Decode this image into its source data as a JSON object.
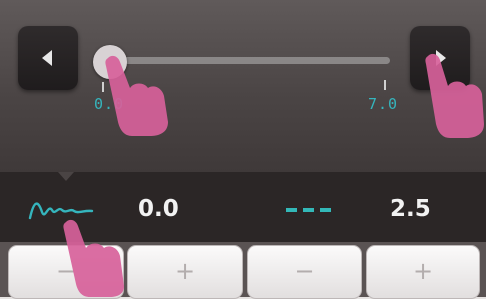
{
  "slider": {
    "value": 0.0,
    "min_label": "0.0",
    "max_label": "7.0"
  },
  "readout": {
    "wave_value": "0.0",
    "fx_value": "2.5"
  },
  "buttons": {
    "decrement_left": "−",
    "increment_left": "+",
    "decrement_right": "−",
    "increment_right": "+"
  },
  "icons": {
    "left_arrow": "arrow-left-icon",
    "right_arrow": "arrow-right-icon",
    "wave": "waveform-icon",
    "dashes": "dashed-line-icon",
    "touch_hand": "touch-hand-icon"
  },
  "colors": {
    "accent": "#35b5bd",
    "touch_hint": "#d7619a"
  }
}
